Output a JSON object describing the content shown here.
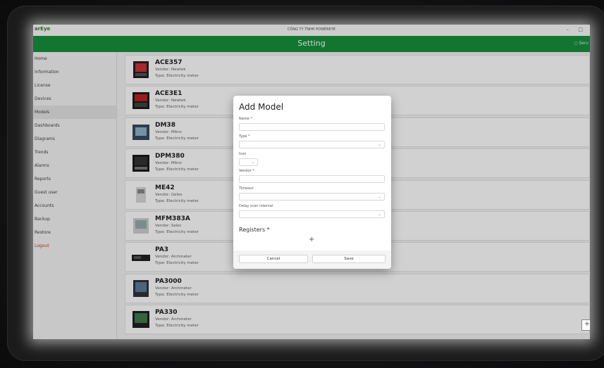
{
  "window": {
    "app_logo": "arEye",
    "title": "CÔNG TY TNHH POWEREYE",
    "minimize": "–",
    "maximize": "□"
  },
  "header": {
    "title": "Setting",
    "status": "○ Serv"
  },
  "sidebar": {
    "items": [
      {
        "label": "Home"
      },
      {
        "label": "Information"
      },
      {
        "label": "License"
      },
      {
        "label": "Devices"
      },
      {
        "label": "Models"
      },
      {
        "label": "Dashboards"
      },
      {
        "label": "Diagrams"
      },
      {
        "label": "Trends"
      },
      {
        "label": "Alarms"
      },
      {
        "label": "Reports"
      },
      {
        "label": "Guest user"
      },
      {
        "label": "Accounts"
      },
      {
        "label": "Backup"
      },
      {
        "label": "Restore"
      },
      {
        "label": "Logout"
      }
    ],
    "active": "Models"
  },
  "models": [
    {
      "name": "ACE357",
      "vendor": "Vendor:  Newtek",
      "type": "Type:  Electricity meter"
    },
    {
      "name": "ACE3E1",
      "vendor": "Vendor:  Newtek",
      "type": "Type:  Electricity meter"
    },
    {
      "name": "DM38",
      "vendor": "Vendor:  Mikro",
      "type": "Type:  Electricity meter"
    },
    {
      "name": "DPM380",
      "vendor": "Vendor:  Mikro",
      "type": "Type:  Electricity meter"
    },
    {
      "name": "ME42",
      "vendor": "Vendor:  Gelex",
      "type": "Type:  Electricity meter"
    },
    {
      "name": "MFM383A",
      "vendor": "Vendor:  Selec",
      "type": "Type:  Electricity meter"
    },
    {
      "name": "PA3",
      "vendor": "Vendor:  Archmeter",
      "type": "Type:  Electricity meter"
    },
    {
      "name": "PA3000",
      "vendor": "Vendor:  Archmeter",
      "type": "Type:  Electricity meter"
    },
    {
      "name": "PA330",
      "vendor": "Vendor:  Archmeter",
      "type": "Type:  Electricity meter"
    }
  ],
  "dialog": {
    "title": "Add Model",
    "name_label": "Name *",
    "type_label": "Type *",
    "icon_label": "Icon",
    "vendor_label": "Vendor *",
    "timeout_label": "Timeout",
    "delay_label": "Delay scan interval",
    "registers_label": "Registers *",
    "add_register": "+",
    "cancel_label": "Cancel",
    "save_label": "Save"
  },
  "fab": {
    "label": "+"
  },
  "colors": {
    "header": "#16913c",
    "logout": "#dd3333"
  }
}
